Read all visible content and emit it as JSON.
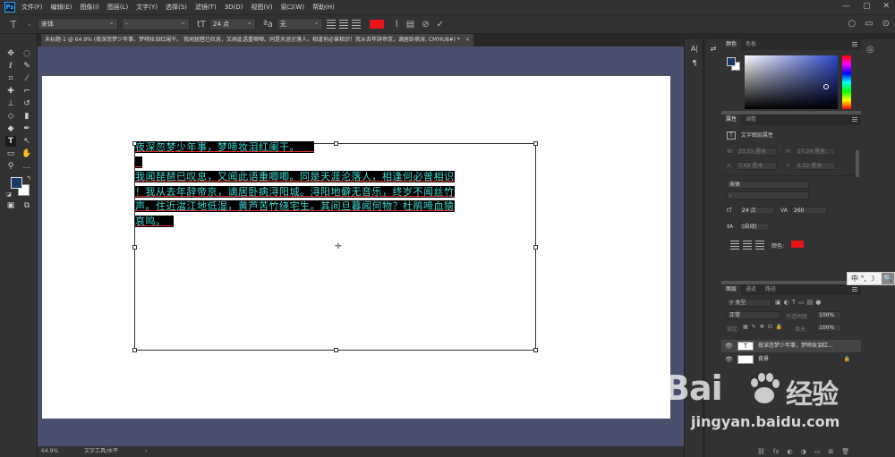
{
  "app": {
    "logo": "Ps"
  },
  "menu": {
    "items": [
      "文件(F)",
      "编辑(E)",
      "图像(I)",
      "图层(L)",
      "文字(Y)",
      "选择(S)",
      "滤镜(T)",
      "3D(D)",
      "视图(V)",
      "窗口(W)",
      "帮助(H)"
    ]
  },
  "window_controls": {
    "minimize": "—",
    "restore": "▢",
    "close": "✕"
  },
  "options_bar": {
    "tool_icon": "T",
    "font_family": "宋体",
    "font_style": "-",
    "size_icon": "tT",
    "font_size": "24 点",
    "aa_icon": "ªa",
    "anti_alias": "无",
    "text_color": "#e8141b",
    "warp_icon": "⌇",
    "panel_icon": "▤",
    "cancel_icon": "⊘",
    "commit_icon": "✓",
    "right_icons": [
      "○",
      "▭",
      "⊙"
    ]
  },
  "document": {
    "tab_title": "未标题-1 @ 64.9% (夜深忽梦少年事，梦啼妆泪红阑干。  我闻琵琶已叹息，又闻此语重唧唧。同是天涯沦落人，相逢何必曾相识！我从去年辞帝京，谪居卧病浔, CMYK/8#) *",
    "text_lines": [
      "夜深忽梦少年事，梦啼妆泪红阑干。",
      "",
      "我闻琵琶已叹息，又闻此语重唧唧。同是天涯沦落人，相逢何必曾相识",
      "！我从去年辞帝京，谪居卧病浔阳城。浔阳地僻无音乐，终岁不闻丝竹",
      "声。住近湓江地低湿，黄芦苦竹绕宅生。其间旦暮闻何物？杜鹃啼血猿",
      "哀鸣。"
    ]
  },
  "statusbar": {
    "zoom": "64.9%",
    "info": "文字工具/水平",
    "arrow": "›"
  },
  "panels": {
    "color": {
      "tabs": [
        "颜色",
        "色板"
      ],
      "fg": "#1a3a66",
      "bg": "#ffffff"
    },
    "properties": {
      "tabs": [
        "属性",
        "调整"
      ],
      "layer_type": "文字图层属性",
      "w_label": "W:",
      "w_value": "33.55 厘米",
      "h_label": "H:",
      "h_value": "17.24 厘米",
      "x_label": "X:",
      "x_value": "7.69 厘米",
      "y_label": "Y:",
      "y_value": "5.32 厘米",
      "font_family": "宋体",
      "font_style": "-",
      "font_size": "24 点",
      "tracking_icon": "VA",
      "tracking": "260",
      "leading_icon": "‡A",
      "leading": "(自动)",
      "color_label": "颜色:",
      "color": "#e8141b"
    },
    "layers": {
      "tabs": [
        "图层",
        "通道",
        "路径"
      ],
      "filter_label": "类型",
      "blend_mode": "正常",
      "opacity_label": "不透明度:",
      "opacity": "100%",
      "lock_label": "锁定:",
      "fill_label": "填充:",
      "fill": "100%",
      "items": [
        {
          "name": "夜深忽梦少年事，梦啼妆泪红...",
          "type": "T"
        },
        {
          "name": "背景",
          "type": ""
        }
      ],
      "bottom_icons": [
        "⛓",
        "fx",
        "◐",
        "◑",
        "▭",
        "⊞",
        "🗑"
      ]
    }
  },
  "ime": {
    "label": "中 °, ☽",
    "search": "🔍"
  },
  "watermark": {
    "brand": "Bai",
    "brand2": "经验",
    "url": "jingyan.baidu.com"
  }
}
